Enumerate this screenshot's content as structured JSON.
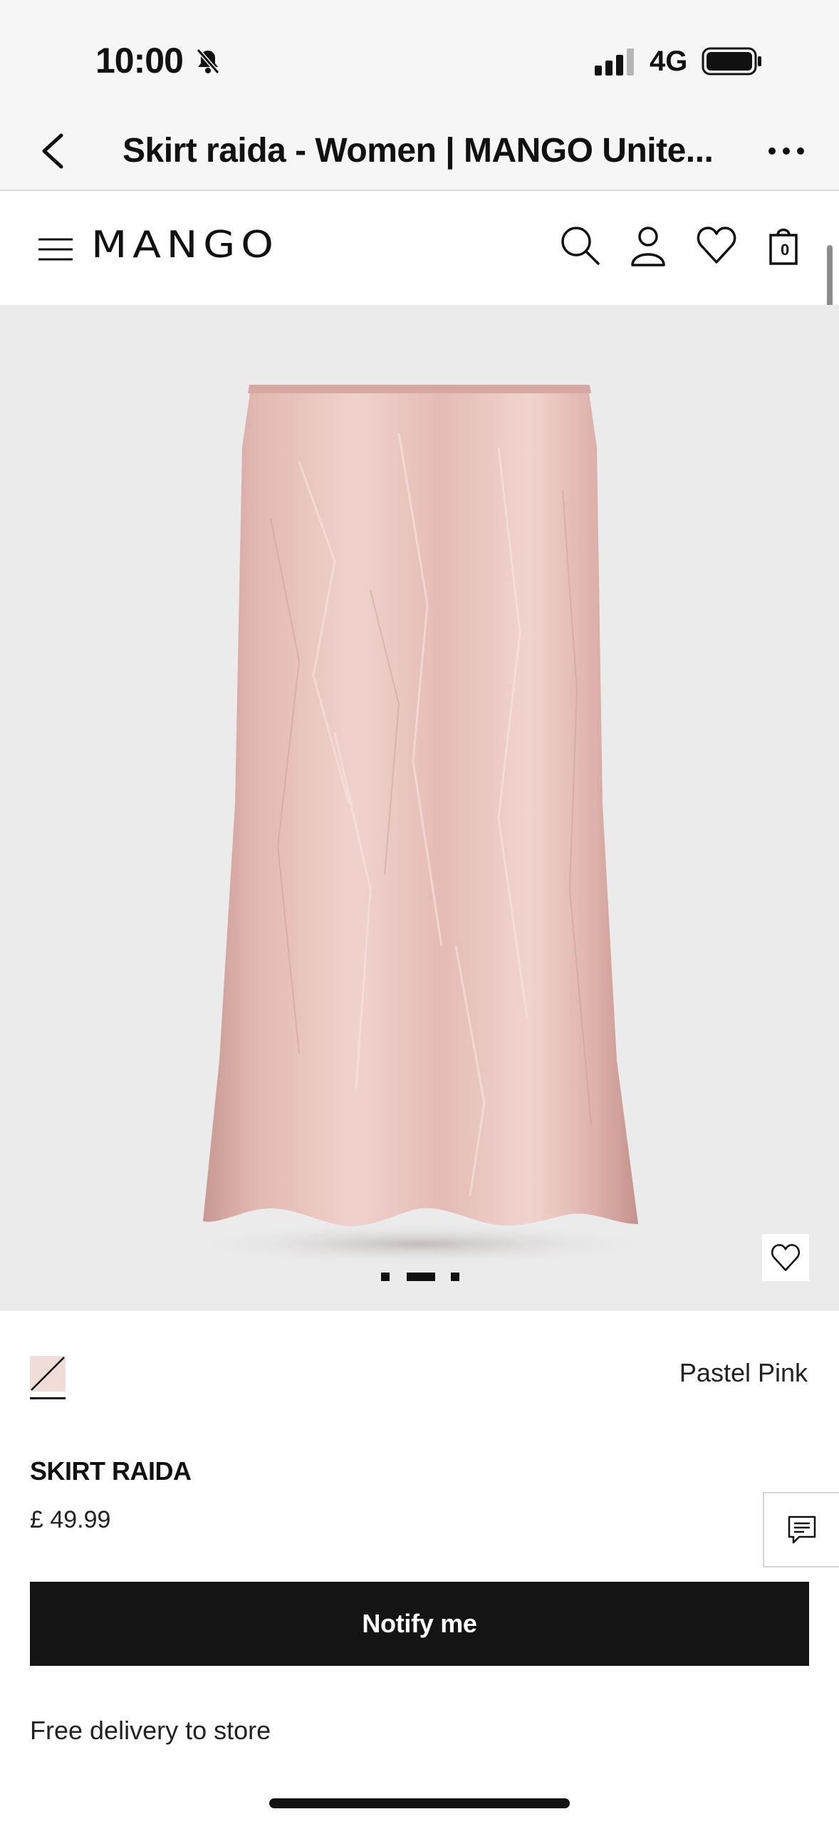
{
  "status_bar": {
    "time": "10:00",
    "network": "4G",
    "icons": [
      "bell-slash-icon",
      "signal-icon",
      "battery-icon"
    ]
  },
  "browser": {
    "page_title": "Skirt raida - Women | MANGO Unite...",
    "icons": [
      "back-icon",
      "more-icon"
    ]
  },
  "header": {
    "logo": "MANGO",
    "cart_count": "0",
    "icons": [
      "menu-icon",
      "search-icon",
      "account-icon",
      "wishlist-icon",
      "bag-icon"
    ]
  },
  "gallery": {
    "image": "pastel pink satin midi skirt",
    "dot_count": 3,
    "active_dot": 2,
    "icons": [
      "heart-icon"
    ]
  },
  "product": {
    "color_name": "Pastel Pink",
    "swatch_color": "#f0dcd8",
    "name": "SKIRT RAIDA",
    "price": "£ 49.99",
    "notify_label": "Notify me",
    "delivery_text": "Free delivery to store"
  },
  "colors": {
    "accent": "#141414",
    "image_bg": "#ebebeb",
    "bar_bg": "#f6f6f6"
  }
}
